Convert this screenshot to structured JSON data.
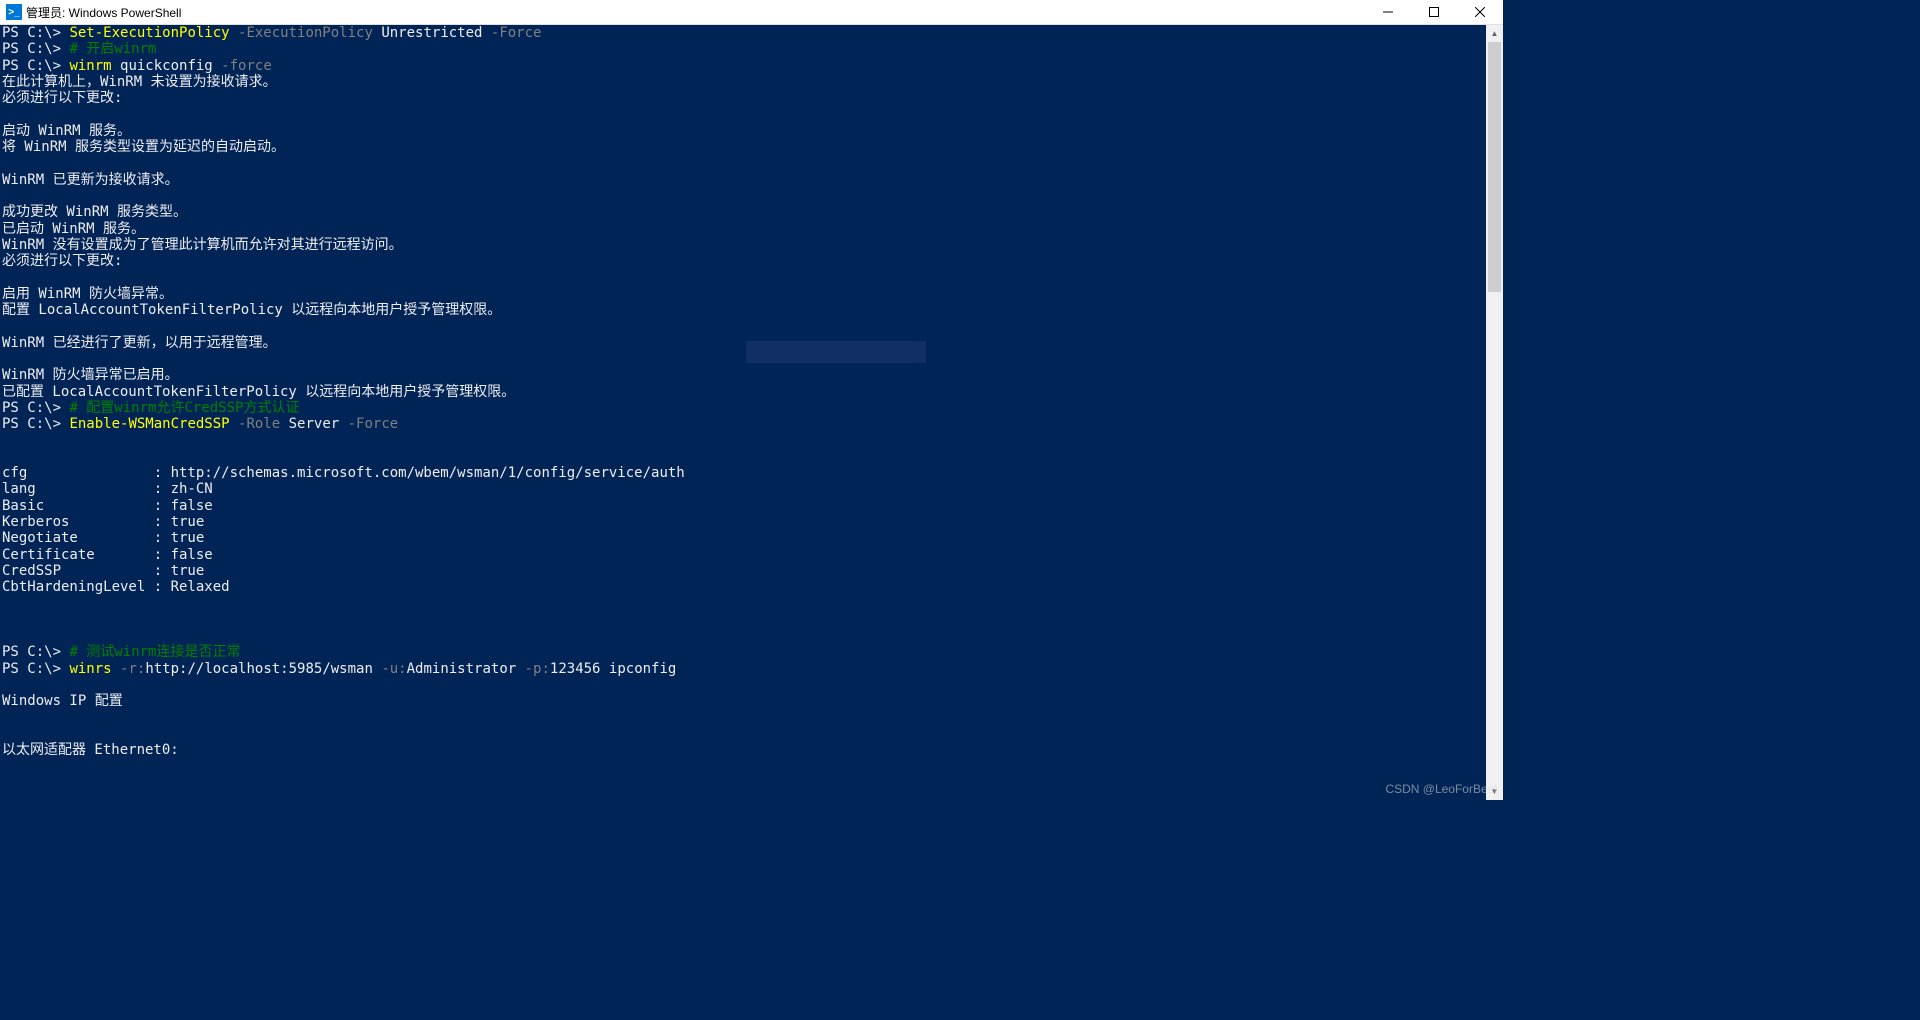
{
  "window": {
    "icon_glyph": ">_",
    "title": "管理员: Windows PowerShell"
  },
  "terminal": {
    "prompt": {
      "text": "PS C:\\> "
    },
    "lines": [
      {
        "type": "cmd",
        "cmd": "Set-ExecutionPolicy",
        "params": " -ExecutionPolicy",
        "rest": " Unrestricted",
        "params2": " -Force"
      },
      {
        "type": "comment",
        "text": "# 开启winrm"
      },
      {
        "type": "cmd",
        "cmd": "winrm",
        "rest_plain": " quickconfig",
        "params": " -force"
      },
      {
        "type": "out",
        "text": "在此计算机上，WinRM 未设置为接收请求。"
      },
      {
        "type": "out",
        "text": "必须进行以下更改:"
      },
      {
        "type": "blank"
      },
      {
        "type": "out",
        "text": "启动 WinRM 服务。"
      },
      {
        "type": "out",
        "text": "将 WinRM 服务类型设置为延迟的自动启动。"
      },
      {
        "type": "blank"
      },
      {
        "type": "out",
        "text": "WinRM 已更新为接收请求。"
      },
      {
        "type": "blank"
      },
      {
        "type": "out",
        "text": "成功更改 WinRM 服务类型。"
      },
      {
        "type": "out",
        "text": "已启动 WinRM 服务。"
      },
      {
        "type": "out",
        "text": "WinRM 没有设置成为了管理此计算机而允许对其进行远程访问。"
      },
      {
        "type": "out",
        "text": "必须进行以下更改:"
      },
      {
        "type": "blank"
      },
      {
        "type": "out",
        "text": "启用 WinRM 防火墙异常。"
      },
      {
        "type": "out",
        "text": "配置 LocalAccountTokenFilterPolicy 以远程向本地用户授予管理权限。"
      },
      {
        "type": "blank"
      },
      {
        "type": "out",
        "text": "WinRM 已经进行了更新，以用于远程管理。"
      },
      {
        "type": "blank"
      },
      {
        "type": "out",
        "text": "WinRM 防火墙异常已启用。"
      },
      {
        "type": "out",
        "text": "已配置 LocalAccountTokenFilterPolicy 以远程向本地用户授予管理权限。"
      },
      {
        "type": "comment",
        "text": "# 配置winrm允许CredSSP方式认证"
      },
      {
        "type": "cmd",
        "cmd": "Enable-WSManCredSSP",
        "params": " -Role",
        "rest": " Server",
        "params2": " -Force"
      },
      {
        "type": "blank"
      },
      {
        "type": "blank"
      },
      {
        "type": "out",
        "text": "cfg               : http://schemas.microsoft.com/wbem/wsman/1/config/service/auth"
      },
      {
        "type": "out",
        "text": "lang              : zh-CN"
      },
      {
        "type": "out",
        "text": "Basic             : false"
      },
      {
        "type": "out",
        "text": "Kerberos          : true"
      },
      {
        "type": "out",
        "text": "Negotiate         : true"
      },
      {
        "type": "out",
        "text": "Certificate       : false"
      },
      {
        "type": "out",
        "text": "CredSSP           : true"
      },
      {
        "type": "out",
        "text": "CbtHardeningLevel : Relaxed"
      },
      {
        "type": "blank"
      },
      {
        "type": "blank"
      },
      {
        "type": "blank"
      },
      {
        "type": "comment",
        "text": "# 测试winrm连接是否正常"
      },
      {
        "type": "cmd2",
        "cmd": "winrs",
        "p1": " -r:",
        "v1": "http://localhost:5985/wsman",
        "p2": " -u:",
        "v2": "Administrator",
        "p3": " -p:",
        "v3": "123456 ipconfig"
      },
      {
        "type": "blank"
      },
      {
        "type": "out",
        "text": "Windows IP 配置"
      },
      {
        "type": "blank"
      },
      {
        "type": "blank"
      },
      {
        "type": "out",
        "text": "以太网适配器 Ethernet0:"
      }
    ]
  },
  "watermark": {
    "text": ""
  },
  "credit": {
    "text": "CSDN @LeoForBest"
  }
}
